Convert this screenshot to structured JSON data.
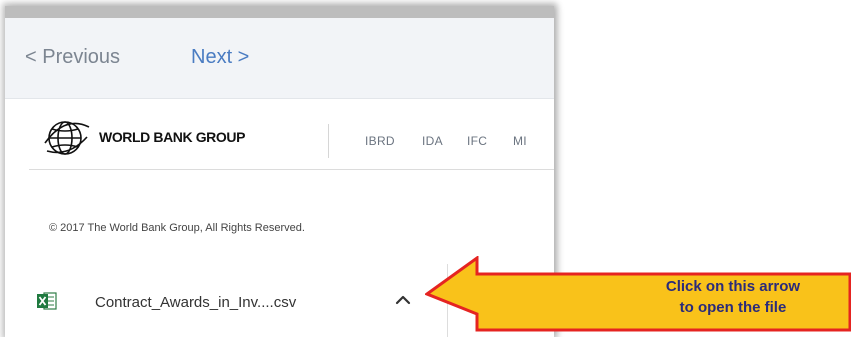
{
  "nav": {
    "previous_label": "< Previous",
    "next_label": "Next >"
  },
  "header": {
    "org_name": "WORLD BANK GROUP",
    "links": [
      "IBRD",
      "IDA",
      "IFC",
      "MI"
    ]
  },
  "footer": {
    "copyright": "© 2017 The World Bank Group, All Rights Reserved."
  },
  "download": {
    "file_name": "Contract_Awards_in_Inv....csv",
    "file_icon": "excel-file-icon",
    "toggle_icon": "chevron-up-icon"
  },
  "callout": {
    "line1": "Click on this arrow",
    "line2": "to open the file",
    "fill_color": "#f9c21a",
    "border_color": "#e52421"
  }
}
